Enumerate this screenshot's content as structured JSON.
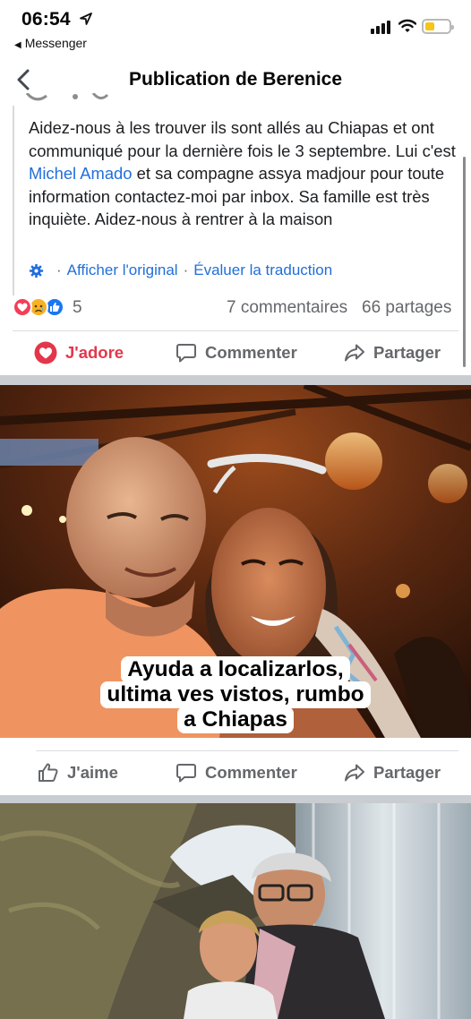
{
  "status_bar": {
    "time": "06:54",
    "back_app": "Messenger"
  },
  "header": {
    "title": "Publication de Berenice"
  },
  "post": {
    "text_before_mention": "Aidez-nous à les trouver ils sont allés au Chiapas et ont communiqué pour la dernière fois le 3 septembre. Lui c'est ",
    "mention": "Michel Amado",
    "text_after_mention": " et sa compagne assya madjour pour toute information contactez-moi par inbox. Sa famille est très inquiète. Aidez-nous à rentrer à la maison",
    "see_original": "Afficher l'original",
    "rate_translation": "Évaluer la traduction",
    "reactions": [
      "love",
      "sad",
      "like"
    ],
    "reaction_count": "5",
    "comments": "7 commentaires",
    "shares": "66 partages"
  },
  "post_actions": {
    "love": "J'adore",
    "comment": "Commenter",
    "share": "Partager"
  },
  "photo1": {
    "caption_lines": [
      "Ayuda a localizarlos,",
      "ultima ves vistos, rumbo",
      "a Chiapas"
    ]
  },
  "photo1_actions": {
    "like": "J'aime",
    "comment": "Commenter",
    "share": "Partager"
  },
  "colors": {
    "accent_blue": "#216fdb",
    "love_red": "#e4364b",
    "secondary_text": "#65676b"
  }
}
